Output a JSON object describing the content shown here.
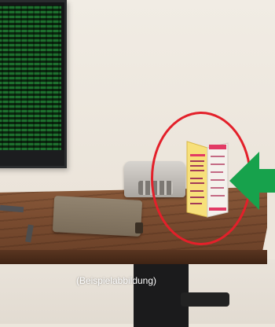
{
  "caption": "(Beispielabbildung)",
  "colors": {
    "highlight_circle": "#e3202a",
    "pointer_arrow": "#17a24c",
    "desk_wood": "#7a4c30",
    "monitor_code": "#2daa46"
  },
  "icons": {
    "pointer": "arrow-left-icon",
    "highlight": "circle-highlight"
  }
}
